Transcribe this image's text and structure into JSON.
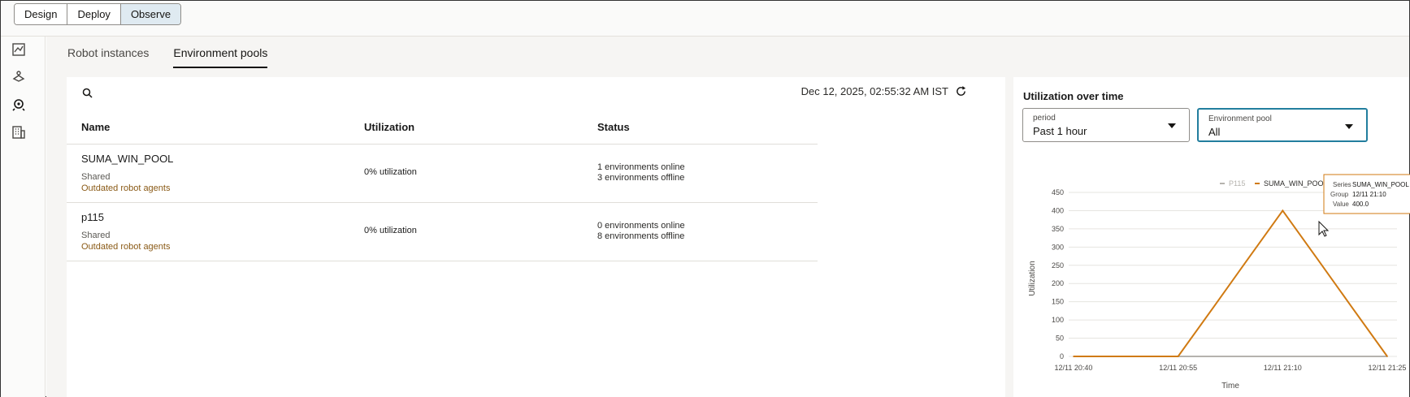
{
  "modes": [
    "Design",
    "Deploy",
    "Observe"
  ],
  "active_mode": "Observe",
  "tabs": [
    "Robot instances",
    "Environment pools"
  ],
  "timestamp": "Dec 12, 2025, 02:55:32 AM IST",
  "table": {
    "headers": [
      "Name",
      "Utilization",
      "Status"
    ],
    "rows": [
      {
        "name": "SUMA_WIN_POOL",
        "type": "Shared",
        "warning": "Outdated robot agents",
        "utilization": "0% utilization",
        "online": "1 environments online",
        "offline": "3 environments offline"
      },
      {
        "name": "p115",
        "type": "Shared",
        "warning": "Outdated robot agents",
        "utilization": "0% utilization",
        "online": "0 environments online",
        "offline": "8 environments offline"
      }
    ]
  },
  "panel": {
    "title": "Utilization over time",
    "period_label": "period",
    "period_value": "Past 1 hour",
    "pool_label": "Environment pool",
    "pool_value": "All"
  },
  "tooltip": {
    "series_label": "Series",
    "series": "SUMA_WIN_POOL",
    "group_label": "Group",
    "group": "12/11 21:10",
    "value_label": "Value",
    "value": "400.0"
  },
  "chart_data": {
    "type": "line",
    "x": [
      "12/11 20:40",
      "12/11 20:45",
      "12/11 20:50",
      "12/11 20:55",
      "12/11 21:00",
      "12/11 21:05",
      "12/11 21:10",
      "12/11 21:15",
      "12/11 21:20",
      "12/11 21:25"
    ],
    "x_ticks": [
      "12/11 20:40",
      "12/11 20:55",
      "12/11 21:10",
      "12/11 21:25"
    ],
    "series": [
      {
        "name": "P115",
        "color": "#b5b3ae",
        "values": [
          0,
          0,
          0,
          0,
          0,
          0,
          0,
          0,
          0,
          0
        ]
      },
      {
        "name": "SUMA_WIN_POOL",
        "color": "#d07a12",
        "values": [
          0,
          0,
          0,
          0,
          133,
          267,
          400,
          267,
          133,
          0
        ]
      }
    ],
    "ylim": [
      0,
      450
    ],
    "yticks": [
      0,
      50,
      100,
      150,
      200,
      250,
      300,
      350,
      400,
      450
    ],
    "xlabel": "Time",
    "ylabel": "Utilization",
    "legend": "top-center",
    "grid": true
  }
}
